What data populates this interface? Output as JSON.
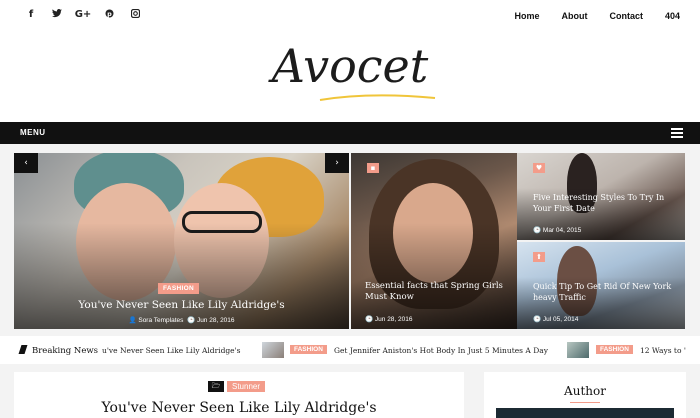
{
  "topbar": {
    "social_icons": [
      {
        "icon": "facebook-icon",
        "glyph": "f"
      },
      {
        "icon": "twitter-icon",
        "glyph": "🐦"
      },
      {
        "icon": "google-plus-icon",
        "glyph": "G+"
      },
      {
        "icon": "pinterest-icon",
        "glyph": "℗"
      },
      {
        "icon": "instagram-icon",
        "glyph": "◘"
      }
    ],
    "nav": [
      "Home",
      "About",
      "Contact",
      "404"
    ]
  },
  "logo": {
    "text": "Avocet"
  },
  "menubar": {
    "label": "MENU"
  },
  "slider": {
    "main": {
      "tag": "FASHION",
      "title": "You've Never Seen Like Lily Aldridge's",
      "author": "Sora Templates",
      "date": "Jun 28, 2016"
    },
    "middle": {
      "title": "Essential facts that Spring Girls Must Know",
      "date": "Jun 28, 2016"
    },
    "right_top": {
      "title": "Five Interesting Styles To Try In Your First Date",
      "date": "Mar 04, 2015"
    },
    "right_bottom": {
      "title": "Quick Tip To Get Rid Of New York heavy Traffic",
      "date": "Jul 05, 2014"
    },
    "prev_glyph": "‹",
    "next_glyph": "›"
  },
  "breaking": {
    "label": "Breaking News",
    "items": [
      {
        "text": "u've Never Seen Like Lily Aldridge's"
      },
      {
        "tag": "FASHION",
        "text": "Get Jennifer Aniston's Hot Body In Just 5 Minutes A Day"
      },
      {
        "tag": "FASHION",
        "text": "12 Ways to '"
      }
    ]
  },
  "post": {
    "category": "Stunner",
    "title": "You've Never Seen Like Lily Aldridge's"
  },
  "sidebar": {
    "widget_title": "Author"
  },
  "colors": {
    "accent": "#f39c8a",
    "dark": "#111111",
    "logo_underline": "#f0c53a"
  }
}
